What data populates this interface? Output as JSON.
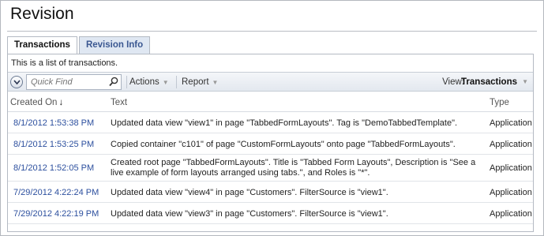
{
  "page": {
    "title": "Revision"
  },
  "tabs": [
    {
      "label": "Transactions",
      "active": true
    },
    {
      "label": "Revision Info",
      "active": false
    }
  ],
  "panel": {
    "description": "This is a list of transactions."
  },
  "toolbar": {
    "quick_find_placeholder": "Quick Find",
    "actions_label": "Actions",
    "report_label": "Report",
    "view_label": "View:",
    "view_value": "Transactions"
  },
  "grid": {
    "columns": [
      {
        "label": "Created On",
        "sort": "descending"
      },
      {
        "label": "Text"
      },
      {
        "label": "Type"
      }
    ],
    "rows": [
      {
        "created_on": "8/1/2012 1:53:38 PM",
        "text": "Updated data view \"view1\" in page \"TabbedFormLayouts\". Tag is \"DemoTabbedTemplate\".",
        "type": "Application"
      },
      {
        "created_on": "8/1/2012 1:53:25 PM",
        "text": "Copied container \"c101\" of page \"CustomFormLayouts\" onto page \"TabbedFormLayouts\".",
        "type": "Application"
      },
      {
        "created_on": "8/1/2012 1:52:05 PM",
        "text": "Created root page \"TabbedFormLayouts\". Title is \"Tabbed Form Layouts\", Description is \"See a live example of form layouts arranged using tabs.\", and Roles is \"*\".",
        "type": "Application"
      },
      {
        "created_on": "7/29/2012 4:22:24 PM",
        "text": "Updated data view \"view4\" in page \"Customers\". FilterSource is \"view1\".",
        "type": "Application"
      },
      {
        "created_on": "7/29/2012 4:22:19 PM",
        "text": "Updated data view \"view3\" in page \"Customers\". FilterSource is \"view1\".",
        "type": "Application"
      }
    ]
  },
  "icons": {
    "menu": "chevron-down-circle-icon",
    "search": "magnifier-icon",
    "sort": "sort-down-arrow-icon",
    "dropdown": "triangle-down-icon"
  },
  "colors": {
    "link": "#2c4f9e",
    "inactive_tab_text": "#3a5791",
    "inactive_tab_bg": "#dfe7f2"
  }
}
